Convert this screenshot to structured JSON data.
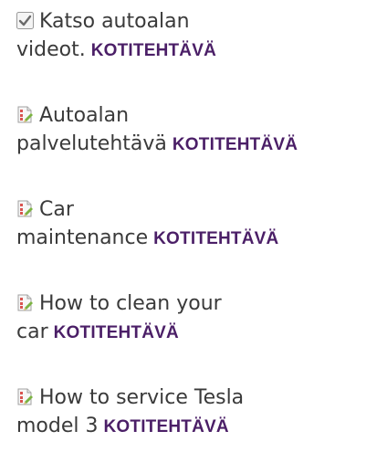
{
  "items": [
    {
      "line1": "Katso autoalan",
      "line2": "videot.",
      "badge": "KOTITEHTÄVÄ",
      "icon": "checkbox-checked-icon"
    },
    {
      "line1": "Autoalan",
      "line2": "palvelutehtävä",
      "badge": "KOTITEHTÄVÄ",
      "icon": "assignment-file-icon"
    },
    {
      "line1": "Car",
      "line2": "maintenance",
      "badge": "KOTITEHTÄVÄ",
      "icon": "assignment-file-icon"
    },
    {
      "line1": "How to clean your",
      "line2": "car",
      "badge": "KOTITEHTÄVÄ",
      "icon": "assignment-file-icon"
    },
    {
      "line1": "How to service Tesla",
      "line2": "model 3",
      "badge": "KOTITEHTÄVÄ",
      "icon": "assignment-file-icon"
    }
  ],
  "colors": {
    "text": "#3a3a3a",
    "badge": "#4b1f67",
    "check": "#6a6a6a",
    "file_red": "#d9534f",
    "file_green": "#7cb342"
  }
}
